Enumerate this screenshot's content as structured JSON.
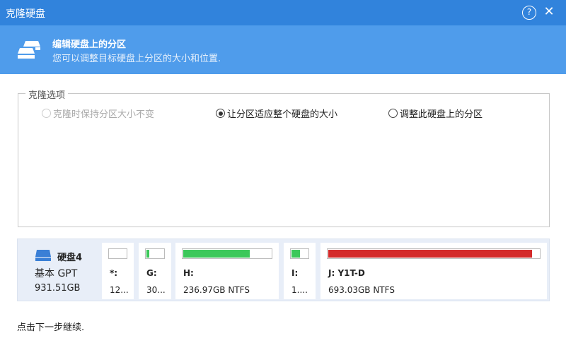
{
  "window": {
    "title": "克隆硬盘",
    "help_icon": "?",
    "close_icon": "✕"
  },
  "header": {
    "title": "编辑硬盘上的分区",
    "subtitle": "您可以调整目标硬盘上分区的大小和位置."
  },
  "clone_options": {
    "legend": "克隆选项",
    "options": [
      {
        "label": "克隆时保持分区大小不变",
        "selected": false,
        "disabled": true
      },
      {
        "label": "让分区适应整个硬盘的大小",
        "selected": true,
        "disabled": false
      },
      {
        "label": "调整此硬盘上的分区",
        "selected": false,
        "disabled": false
      }
    ]
  },
  "disk": {
    "name": "硬盘4",
    "type": "基本 GPT",
    "size": "931.51GB",
    "partitions": [
      {
        "label": "*:",
        "size": "12...",
        "used": 0,
        "color": "#3cc85a"
      },
      {
        "label": "G:",
        "size": "30...",
        "used": 0.15,
        "color": "#3cc85a"
      },
      {
        "label": "H:",
        "size": "236.97GB NTFS",
        "used": 0.76,
        "color": "#3cc85a"
      },
      {
        "label": "I:",
        "size": "1....",
        "used": 0.5,
        "color": "#3cc85a"
      },
      {
        "label": "J: Y1T-D",
        "size": "693.03GB NTFS",
        "used": 0.965,
        "color": "#d42a2a"
      }
    ]
  },
  "footer": {
    "hint": "点击下一步继续."
  }
}
